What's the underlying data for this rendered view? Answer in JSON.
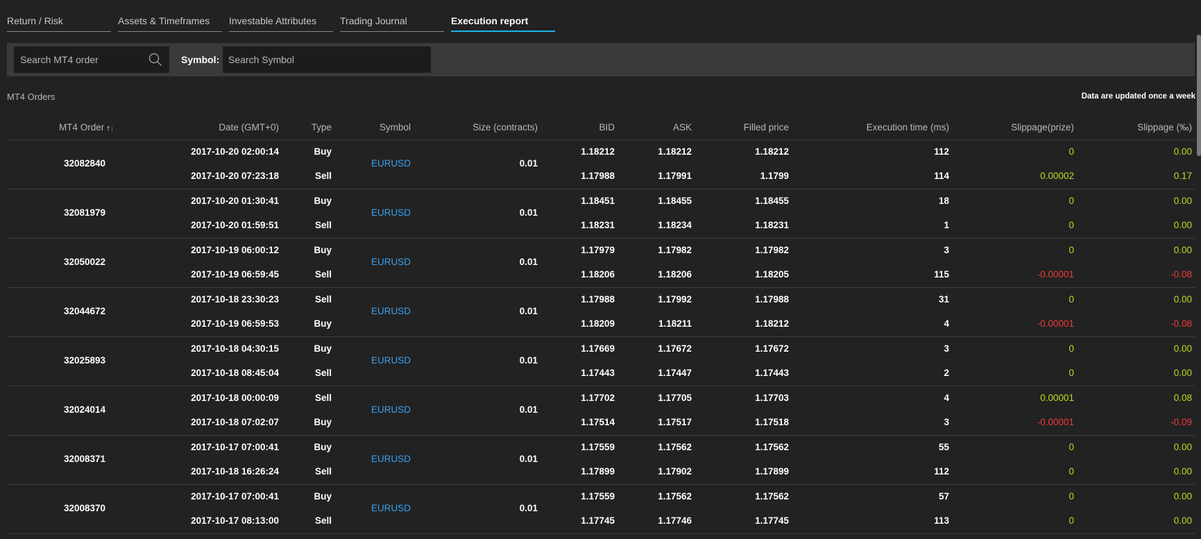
{
  "tabs": [
    {
      "label": "Return / Risk",
      "active": false
    },
    {
      "label": "Assets & Timeframes",
      "active": false
    },
    {
      "label": "Investable Attributes",
      "active": false
    },
    {
      "label": "Trading Journal",
      "active": false
    },
    {
      "label": "Execution report",
      "active": true
    }
  ],
  "filters": {
    "order_placeholder": "Search MT4 order",
    "symbol_label": "Symbol:",
    "symbol_placeholder": "Search Symbol"
  },
  "section": {
    "title": "MT4 Orders",
    "note": "Data are updated once a week"
  },
  "columns": {
    "order": "MT4 Order",
    "date": "Date (GMT+0)",
    "type": "Type",
    "symbol": "Symbol",
    "size": "Size (contracts)",
    "bid": "BID",
    "ask": "ASK",
    "filled": "Filled price",
    "exec": "Execution time (ms)",
    "slip_prize": "Slippage(prize)",
    "slip_pct": "Slippage (‰)"
  },
  "sort_icon": {
    "up": "↑",
    "down": "↓"
  },
  "colors": {
    "accent": "#1ab5e6",
    "symbol": "#3aa0f0",
    "positive": "#b8e021",
    "negative": "#f03a3a"
  },
  "orders": [
    {
      "id": "32082840",
      "symbol": "EURUSD",
      "size": "0.01",
      "legs": [
        {
          "date": "2017-10-20 02:00:14",
          "type": "Buy",
          "bid": "1.18212",
          "ask": "1.18212",
          "filled": "1.18212",
          "exec": "112",
          "slip_prize": "0",
          "slip_pct": "0.00",
          "sign": "pos"
        },
        {
          "date": "2017-10-20 07:23:18",
          "type": "Sell",
          "bid": "1.17988",
          "ask": "1.17991",
          "filled": "1.1799",
          "exec": "114",
          "slip_prize": "0.00002",
          "slip_pct": "0.17",
          "sign": "pos"
        }
      ]
    },
    {
      "id": "32081979",
      "symbol": "EURUSD",
      "size": "0.01",
      "legs": [
        {
          "date": "2017-10-20 01:30:41",
          "type": "Buy",
          "bid": "1.18451",
          "ask": "1.18455",
          "filled": "1.18455",
          "exec": "18",
          "slip_prize": "0",
          "slip_pct": "0.00",
          "sign": "pos"
        },
        {
          "date": "2017-10-20 01:59:51",
          "type": "Sell",
          "bid": "1.18231",
          "ask": "1.18234",
          "filled": "1.18231",
          "exec": "1",
          "slip_prize": "0",
          "slip_pct": "0.00",
          "sign": "pos"
        }
      ]
    },
    {
      "id": "32050022",
      "symbol": "EURUSD",
      "size": "0.01",
      "legs": [
        {
          "date": "2017-10-19 06:00:12",
          "type": "Buy",
          "bid": "1.17979",
          "ask": "1.17982",
          "filled": "1.17982",
          "exec": "3",
          "slip_prize": "0",
          "slip_pct": "0.00",
          "sign": "pos"
        },
        {
          "date": "2017-10-19 06:59:45",
          "type": "Sell",
          "bid": "1.18206",
          "ask": "1.18206",
          "filled": "1.18205",
          "exec": "115",
          "slip_prize": "-0.00001",
          "slip_pct": "-0.08",
          "sign": "neg"
        }
      ]
    },
    {
      "id": "32044672",
      "symbol": "EURUSD",
      "size": "0.01",
      "legs": [
        {
          "date": "2017-10-18 23:30:23",
          "type": "Sell",
          "bid": "1.17988",
          "ask": "1.17992",
          "filled": "1.17988",
          "exec": "31",
          "slip_prize": "0",
          "slip_pct": "0.00",
          "sign": "pos"
        },
        {
          "date": "2017-10-19 06:59:53",
          "type": "Buy",
          "bid": "1.18209",
          "ask": "1.18211",
          "filled": "1.18212",
          "exec": "4",
          "slip_prize": "-0.00001",
          "slip_pct": "-0.08",
          "sign": "neg"
        }
      ]
    },
    {
      "id": "32025893",
      "symbol": "EURUSD",
      "size": "0.01",
      "legs": [
        {
          "date": "2017-10-18 04:30:15",
          "type": "Buy",
          "bid": "1.17669",
          "ask": "1.17672",
          "filled": "1.17672",
          "exec": "3",
          "slip_prize": "0",
          "slip_pct": "0.00",
          "sign": "pos"
        },
        {
          "date": "2017-10-18 08:45:04",
          "type": "Sell",
          "bid": "1.17443",
          "ask": "1.17447",
          "filled": "1.17443",
          "exec": "2",
          "slip_prize": "0",
          "slip_pct": "0.00",
          "sign": "pos"
        }
      ]
    },
    {
      "id": "32024014",
      "symbol": "EURUSD",
      "size": "0.01",
      "legs": [
        {
          "date": "2017-10-18 00:00:09",
          "type": "Sell",
          "bid": "1.17702",
          "ask": "1.17705",
          "filled": "1.17703",
          "exec": "4",
          "slip_prize": "0.00001",
          "slip_pct": "0.08",
          "sign": "pos"
        },
        {
          "date": "2017-10-18 07:02:07",
          "type": "Buy",
          "bid": "1.17514",
          "ask": "1.17517",
          "filled": "1.17518",
          "exec": "3",
          "slip_prize": "-0.00001",
          "slip_pct": "-0.09",
          "sign": "neg"
        }
      ]
    },
    {
      "id": "32008371",
      "symbol": "EURUSD",
      "size": "0.01",
      "legs": [
        {
          "date": "2017-10-17 07:00:41",
          "type": "Buy",
          "bid": "1.17559",
          "ask": "1.17562",
          "filled": "1.17562",
          "exec": "55",
          "slip_prize": "0",
          "slip_pct": "0.00",
          "sign": "pos"
        },
        {
          "date": "2017-10-18 16:26:24",
          "type": "Sell",
          "bid": "1.17899",
          "ask": "1.17902",
          "filled": "1.17899",
          "exec": "112",
          "slip_prize": "0",
          "slip_pct": "0.00",
          "sign": "pos"
        }
      ]
    },
    {
      "id": "32008370",
      "symbol": "EURUSD",
      "size": "0.01",
      "legs": [
        {
          "date": "2017-10-17 07:00:41",
          "type": "Buy",
          "bid": "1.17559",
          "ask": "1.17562",
          "filled": "1.17562",
          "exec": "57",
          "slip_prize": "0",
          "slip_pct": "0.00",
          "sign": "pos"
        },
        {
          "date": "2017-10-17 08:13:00",
          "type": "Sell",
          "bid": "1.17745",
          "ask": "1.17746",
          "filled": "1.17745",
          "exec": "113",
          "slip_prize": "0",
          "slip_pct": "0.00",
          "sign": "pos"
        }
      ]
    }
  ]
}
